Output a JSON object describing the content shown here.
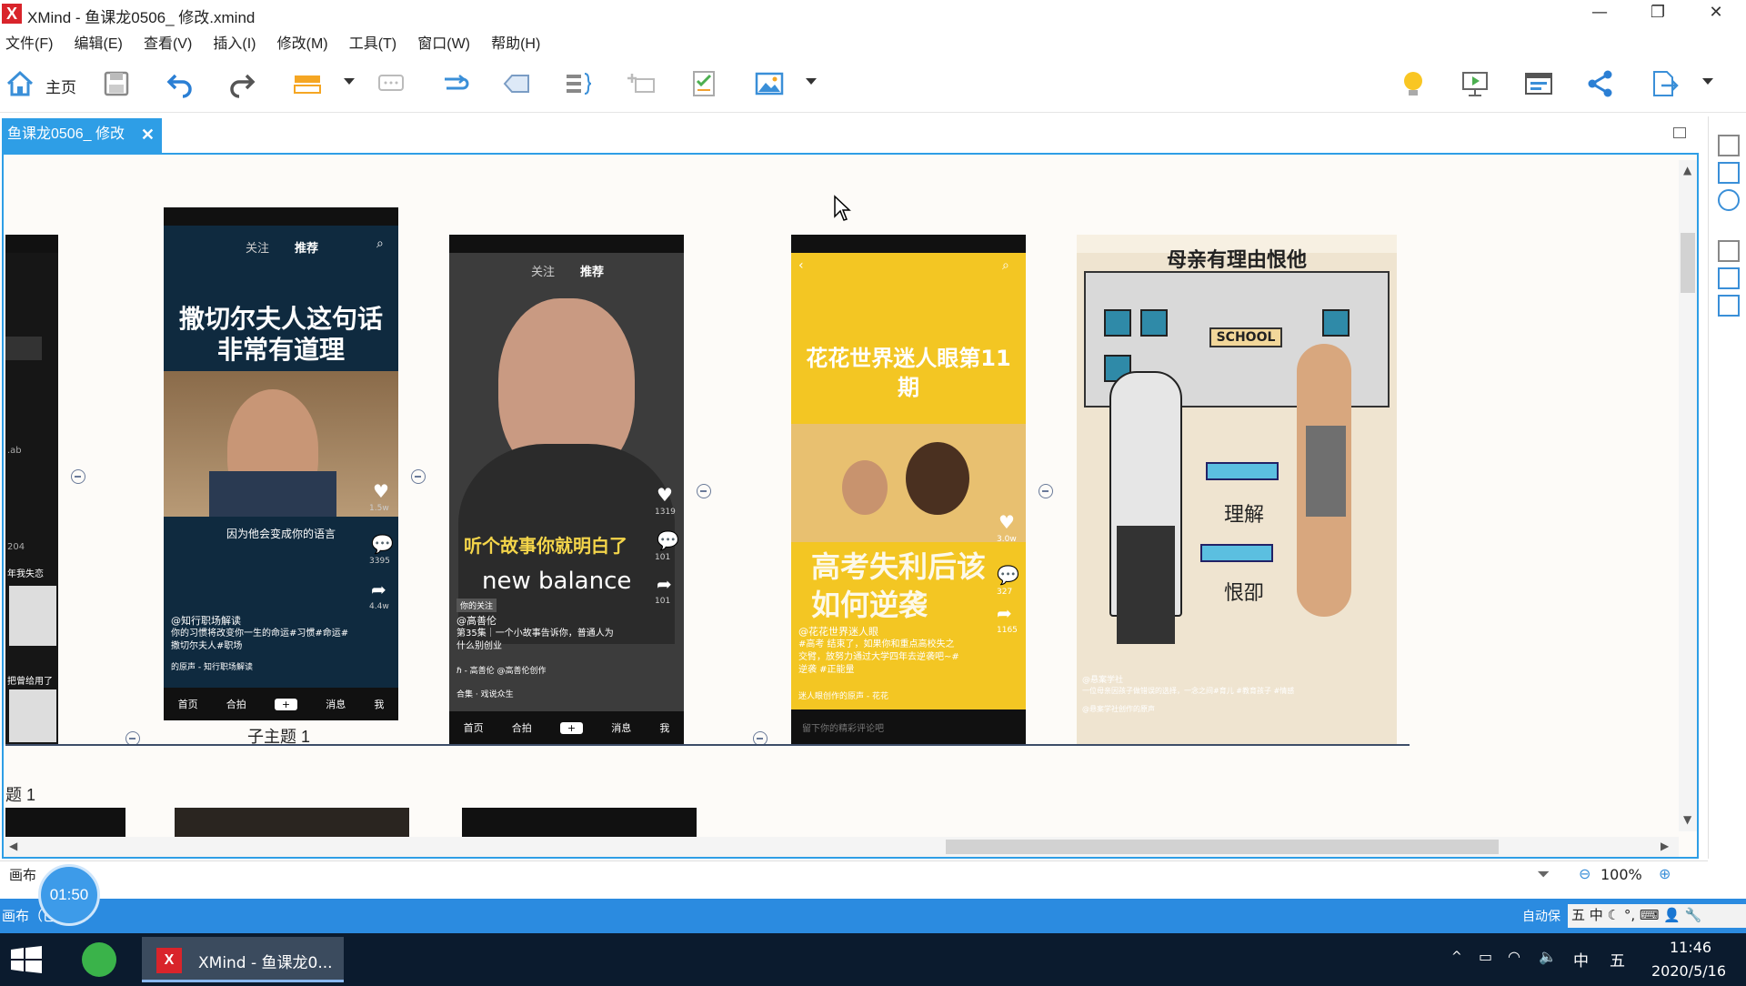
{
  "window": {
    "title": "XMind - 鱼课龙0506_ 修改.xmind",
    "logo": "X",
    "minimize": "—",
    "restore": "❐",
    "close": "✕"
  },
  "menu": [
    "文件(F)",
    "编辑(E)",
    "查看(V)",
    "插入(I)",
    "修改(M)",
    "工具(T)",
    "窗口(W)",
    "帮助(H)"
  ],
  "toolbar": {
    "home_label": "主页",
    "icons": [
      "home-icon",
      "save-icon",
      "undo-icon",
      "redo-icon",
      "topic-icon",
      "comment-icon",
      "relationship-icon",
      "boundary-icon",
      "summary-icon",
      "add-topic-icon",
      "task-icon",
      "image-icon",
      "idea-icon",
      "presentation-icon",
      "outliner-icon",
      "share-icon",
      "export-icon"
    ]
  },
  "tab": {
    "label": "鱼课龙0506_ 修改",
    "close": "✕"
  },
  "canvas": {
    "phones": [
      {
        "id": "p0",
        "side_texts": [
          ".ab",
          "204",
          "年我失恋",
          "把曾给用了"
        ]
      },
      {
        "id": "p1",
        "tabs": [
          "关注",
          "推荐"
        ],
        "headline": "撒切尔夫人这句话非常有道理",
        "subtitle": "因为他会变成你的语言",
        "account": "@知行职场解读",
        "desc": "你的习惯将改变你一生的命运#习惯#命运#撒切尔夫人#职场",
        "music": "的原声 - 知行职场解读",
        "counts": [
          "1.5w",
          "3395",
          "4.4w"
        ],
        "nav": [
          "首页",
          "合拍",
          "+",
          "消息",
          "我"
        ],
        "caption": "子主题 1"
      },
      {
        "id": "p2",
        "tabs": [
          "关注",
          "推荐"
        ],
        "overlay": "听个故事你就明白了",
        "brand": "new balance",
        "tag": "你的关注",
        "account": "@高善伦",
        "desc": "第35集｜一个小故事告诉你，普通人为什么别创业",
        "music": "ℏ - 高善伦 @高善伦创作",
        "collection": "合集 · 戏说众生",
        "counts": [
          "1319",
          "101",
          "101"
        ],
        "nav": [
          "首页",
          "合拍",
          "+",
          "消息",
          "我"
        ]
      },
      {
        "id": "p3",
        "headline": "花花世界迷人眼第11期",
        "overlay": "高考失利后该如何逆袭",
        "account": "@花花世界迷人眼",
        "desc": "#高考 结束了，如果你和重点高校失之交臂，放努力通过大学四年去逆袭吧~#逆袭 #正能量",
        "music": "迷人眼创作的原声 - 花花",
        "comment_placeholder": "留下你的精彩评论吧",
        "counts": [
          "3.0w",
          "327",
          "1165"
        ]
      },
      {
        "id": "p4",
        "headline": "母亲有理由恨他",
        "school": "SCHOOL",
        "label_understand": "理解",
        "label_hate": "恨卲",
        "account": "@悬案学社",
        "desc": "一位母亲因孩子做错误的选择，一念之间#育儿 #教育孩子 #情感",
        "music": "@悬案学社创作的原声"
      }
    ],
    "branch_label": "题 1"
  },
  "statusbar": {
    "canvas_label": "画布",
    "zoom": "100%",
    "timer": "01:50",
    "lower_label": "画布（已...）",
    "autosave": "自动保"
  },
  "taskbar": {
    "app_label": "XMind - 鱼课龙0...",
    "time": "11:46",
    "date": "2020/5/16",
    "ime": [
      "五",
      "中",
      "五"
    ]
  }
}
